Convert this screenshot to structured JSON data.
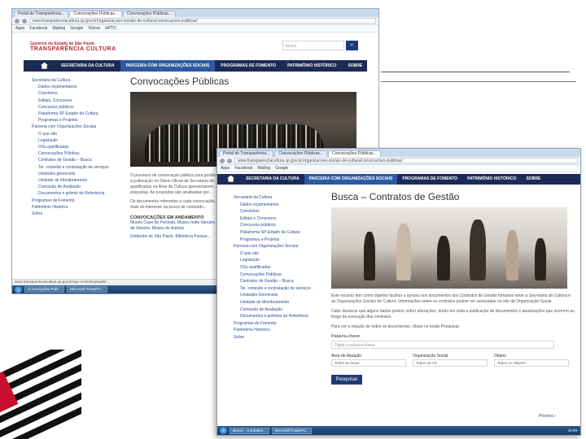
{
  "windowA": {
    "tabs": [
      "Portal de Transparência...",
      "Convocações Públicas...",
      "Convocações Públicas..."
    ],
    "url": "www.transparenciacultura.sp.gov.br/organizacoes-sociais-de-cultura/convocacoes-publicas/",
    "bookmarks": [
      "Apps",
      "Facebook",
      "Mailing",
      "Google",
      "Outros",
      "APTO"
    ],
    "logo_top": "Governo do Estado de São Paulo",
    "logo_main": "TRANSPARÊNCIA CULTURA",
    "search_placeholder": "busca",
    "nav": [
      "SECRETARIA DA CULTURA",
      "PARCERIA COM ORGANIZAÇÕES SOCIAIS",
      "PROGRAMAS DE FOMENTO",
      "PATRIMÔNIO HISTÓRICO",
      "SOBRE"
    ],
    "sidebar": [
      {
        "label": "Secretaria da Cultura",
        "sub": false
      },
      {
        "label": "Dados orçamentários",
        "sub": true
      },
      {
        "label": "Convênios",
        "sub": true
      },
      {
        "label": "Editais, Concursos",
        "sub": true
      },
      {
        "label": "Concursos públicos",
        "sub": true
      },
      {
        "label": "Plataforma SP Estado da Cultura",
        "sub": true
      },
      {
        "label": "Programas e Projetos",
        "sub": true
      },
      {
        "label": "Parceria com Organizações Sociais",
        "sub": false
      },
      {
        "label": "O que são",
        "sub": true
      },
      {
        "label": "Legislação",
        "sub": true
      },
      {
        "label": "OSs qualificadas",
        "sub": true
      },
      {
        "label": "Convocações Públicas",
        "sub": true
      },
      {
        "label": "Contratos de Gestão – Busca",
        "sub": true
      },
      {
        "label": "Ter. conexão e contratação de serviços",
        "sub": true
      },
      {
        "label": "Unidades gerenciais",
        "sub": true
      },
      {
        "label": "Unidade de Monitoramento",
        "sub": true
      },
      {
        "label": "Comissão de Avaliação",
        "sub": true
      },
      {
        "label": "Documentos e prêmio de Referência",
        "sub": true
      },
      {
        "label": "Programas de Fomento",
        "sub": false
      },
      {
        "label": "Patrimônio Histórico",
        "sub": false
      },
      {
        "label": "Sobre",
        "sub": false
      }
    ],
    "title": "Convocações Públicas",
    "text_lines": [
      "O processo de convocação pública para gestão de equipamentos culturais...",
      "a publicação no Diário Oficial da Secretaria de...",
      "qualificadas na Área de Cultura apresentarem...",
      "propostas. As propostas são analisadas por...",
      "Os documentos referentes a cada convocação...",
      "mais do interesse na busca de conteúdo..."
    ],
    "subheading": "CONVOCAÇÕES EM ANDAMENTO",
    "links": [
      "Museu Casa de Portinari, Museu Índia Vanuíre...",
      "de Vanuíre, Museu de Autoria",
      "Unidades de São Paulo, Biblioteca Parque..."
    ],
    "status_url": "www.transparenciacultura.sp.gov.br/wp-content/uploads/...",
    "taskbar": [
      "Convocações Públ...",
      "Microsoft PowerPo..."
    ]
  },
  "windowB": {
    "nav": [
      "SECRETARIA DA CULTURA",
      "PARCERIA COM ORGANIZAÇÕES SOCIAIS",
      "PROGRAMAS DE FOMENTO",
      "PATRIMÔNIO HISTÓRICO",
      "SOBRE"
    ],
    "sidebar": [
      {
        "label": "Secretaria da Cultura",
        "sub": false
      },
      {
        "label": "Dados orçamentários",
        "sub": true
      },
      {
        "label": "Convênios",
        "sub": true
      },
      {
        "label": "Editais e Concursos",
        "sub": true
      },
      {
        "label": "Concursos públicos",
        "sub": true
      },
      {
        "label": "Plataforma SP Estado da Cultura",
        "sub": true
      },
      {
        "label": "Programas e Projetos",
        "sub": true
      },
      {
        "label": "Parceria com Organizações Sociais",
        "sub": false
      },
      {
        "label": "O que são",
        "sub": true
      },
      {
        "label": "Legislação",
        "sub": true
      },
      {
        "label": "OSs qualificadas",
        "sub": true
      },
      {
        "label": "Convocações Públicas",
        "sub": true
      },
      {
        "label": "Contratos de Gestão – Busca",
        "sub": true
      },
      {
        "label": "Ter. conexão e contratação de serviços",
        "sub": true
      },
      {
        "label": "Unidades Gerenciais",
        "sub": true
      },
      {
        "label": "Unidade de Monitoramento",
        "sub": true
      },
      {
        "label": "Comissão de Avaliação",
        "sub": true
      },
      {
        "label": "Documentos e prêmios de Referência",
        "sub": true
      },
      {
        "label": "Programas de Fomento",
        "sub": false
      },
      {
        "label": "Patrimônio Histórico",
        "sub": false
      },
      {
        "label": "Sobre",
        "sub": false
      }
    ],
    "title": "Busca – Contratos de Gestão",
    "text1": "Este recurso tem como objetivo facilitar o acesso aos documentos dos Contratos de Gestão firmados entre a Secretaria da Cultura e as Organizações Sociais de Cultura. Informações sobre os contratos podem ser acessadas no site da Organização Social.",
    "text2": "Cabe destacar que alguns dados podem sofrer alterações, tendo em vista a publicação de documentos e atualizações que ocorrem ao longo da execução dos contratos.",
    "text3": "Para ver a relação de todos os documentos, clique no botão Pesquisar.",
    "search_label": "Palavra-chave",
    "search_placeholder": "Digite a palavra-chave",
    "filters": [
      {
        "label": "Área de Atuação",
        "value": "Todas as áreas"
      },
      {
        "label": "Organização Social",
        "value": "Todas as OS"
      },
      {
        "label": "Objeto",
        "value": "Todos os Objetos"
      }
    ],
    "button": "Pesquisar",
    "pagination": "Próxima ›",
    "taskbar": [
      "Busca – Contratos...",
      "Microsoft PowerPo..."
    ],
    "clock": "15:09"
  }
}
